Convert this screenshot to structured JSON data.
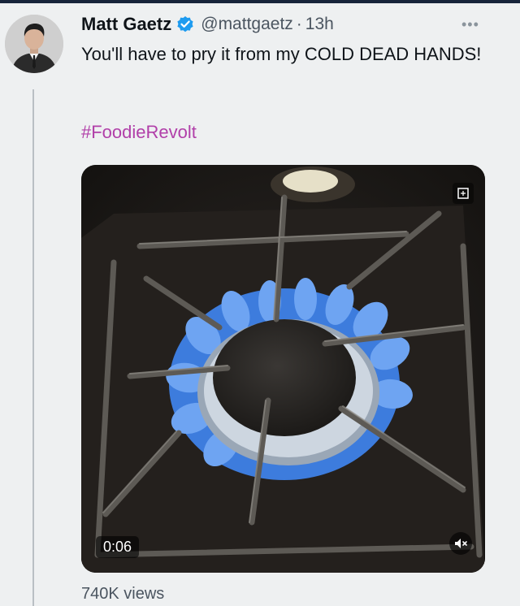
{
  "tweet": {
    "author_name": "Matt Gaetz",
    "handle": "@mattgaetz",
    "separator": "·",
    "time": "13h",
    "text": "You'll have to pry it from my COLD DEAD HANDS!",
    "hashtag": "#FoodieRevolt",
    "verified_icon": "verified-badge-icon",
    "more_icon": "more-options-icon"
  },
  "video": {
    "timestamp": "0:06",
    "views": "740K views",
    "icons": [
      "volume-muted-icon",
      "expand-icon"
    ]
  },
  "colors": {
    "hashtag": "#b13fa9",
    "verified": "#1d9bf0",
    "flame": "#3f82e8",
    "muted_text": "#4b5560"
  }
}
